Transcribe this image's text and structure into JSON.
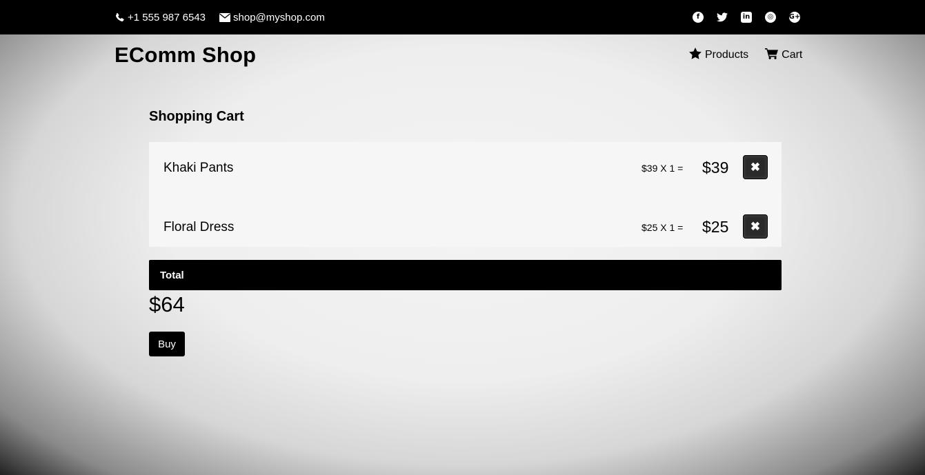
{
  "topbar": {
    "phone": "+1 555 987 6543",
    "email": "shop@myshop.com",
    "social_icons": [
      "facebook-icon",
      "twitter-icon",
      "linkedin-icon",
      "dribbble-icon",
      "google-plus-icon"
    ],
    "social_glyphs": [
      "f",
      "🐦",
      "in",
      "◎",
      "G+"
    ]
  },
  "header": {
    "brand": "EComm Shop",
    "nav": [
      {
        "label": "Products",
        "icon": "star-icon"
      },
      {
        "label": "Cart",
        "icon": "cart-icon"
      }
    ]
  },
  "cart": {
    "title": "Shopping Cart",
    "items": [
      {
        "name": "Khaki Pants",
        "calc": "$39 X 1 =",
        "subtotal": "$39",
        "remove_glyph": "✖"
      },
      {
        "name": "Floral Dress",
        "calc": "$25 X 1 =",
        "subtotal": "$25",
        "remove_glyph": "✖"
      }
    ],
    "total_label": "Total",
    "total_amount": "$64",
    "buy_label": "Buy"
  },
  "colors": {
    "topbar_bg": "#000000",
    "button_bg": "#000000",
    "remove_bg": "#2a2a2a"
  }
}
